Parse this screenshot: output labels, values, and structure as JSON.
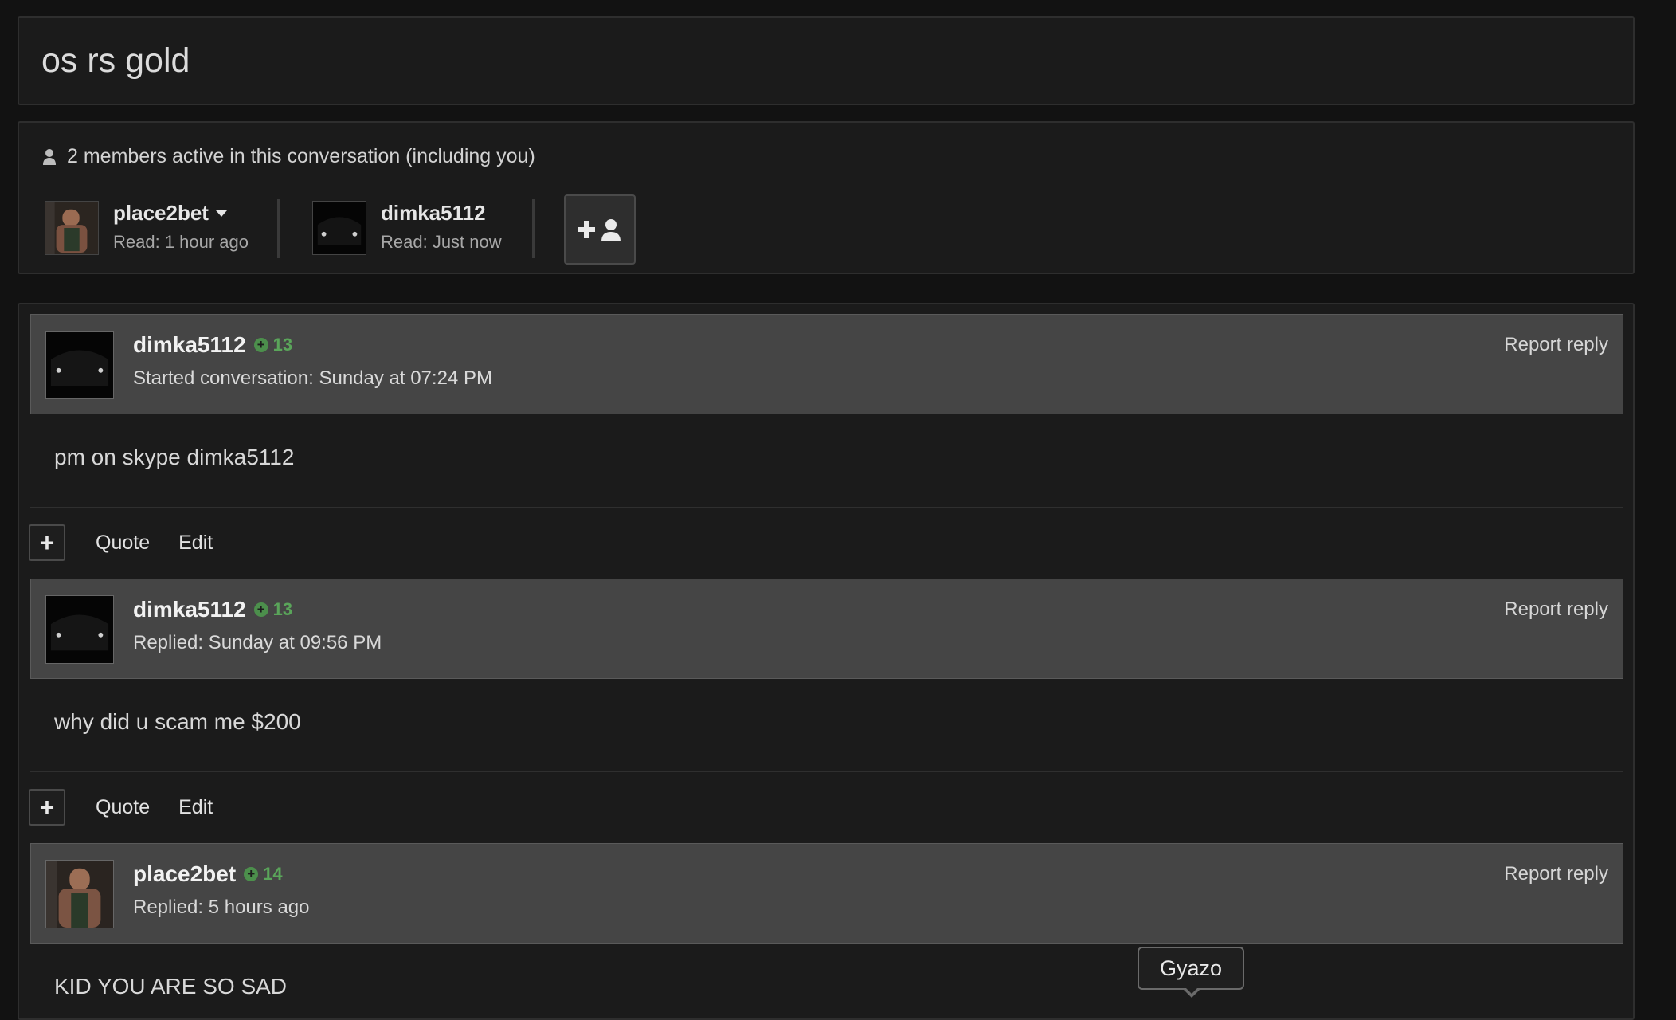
{
  "conversation": {
    "title": "os rs gold"
  },
  "members": {
    "header": "2 members active in this conversation (including you)",
    "list": [
      {
        "name": "place2bet",
        "read": "Read: 1 hour ago",
        "has_menu": true
      },
      {
        "name": "dimka5112",
        "read": "Read: Just now",
        "has_menu": false
      }
    ],
    "invite_icon": "add-user-icon"
  },
  "messages": [
    {
      "user": "dimka5112",
      "rep": "13",
      "meta": "Started conversation: Sunday at 07:24 PM",
      "report": "Report reply",
      "body": "pm on skype dimka5112"
    },
    {
      "user": "dimka5112",
      "rep": "13",
      "meta": "Replied: Sunday at 09:56 PM",
      "report": "Report reply",
      "body": "why did u scam me $200"
    },
    {
      "user": "place2bet",
      "rep": "14",
      "meta": "Replied: 5 hours ago",
      "report": "Report reply",
      "body": "KID YOU ARE SO SAD"
    }
  ],
  "actions": {
    "plus": "+",
    "quote": "Quote",
    "edit": "Edit"
  },
  "tooltip": {
    "text": "Gyazo"
  }
}
